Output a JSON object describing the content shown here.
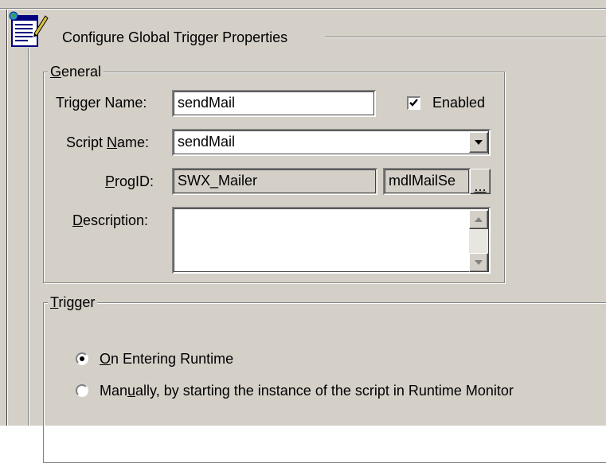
{
  "dialog": {
    "title": "Configure Global Trigger Properties"
  },
  "general": {
    "legend_prefix": "G",
    "legend_rest": "eneral",
    "trigger_name_label": "Trigger Name:",
    "trigger_name_value": "sendMail",
    "enabled_label": "Enabled",
    "enabled_checked": true,
    "script_name_label_pre": "Script ",
    "script_name_label_u": "N",
    "script_name_label_post": "ame:",
    "script_name_value": "sendMail",
    "progid_label_u": "P",
    "progid_label_post": "rogID:",
    "progid_value": "SWX_Mailer",
    "progid_class_value": "mdlMailSe",
    "browse_label": "...",
    "description_label_u": "D",
    "description_label_post": "escription:",
    "description_value": ""
  },
  "trigger": {
    "legend_u": "T",
    "legend_rest": "rigger",
    "option1_u": "O",
    "option1_rest": "n Entering Runtime",
    "option1_selected": true,
    "option2_pre": "Man",
    "option2_u": "u",
    "option2_rest": "ally, by starting the instance of the script in Runtime Monitor",
    "option2_selected": false
  },
  "icons": {
    "dialog_icon": "notepad-icon",
    "dropdown_icon": "chevron-down-icon",
    "scroll_up_icon": "scroll-up-arrow-icon",
    "scroll_down_icon": "scroll-down-arrow-icon",
    "check_icon": "checkmark-icon"
  }
}
